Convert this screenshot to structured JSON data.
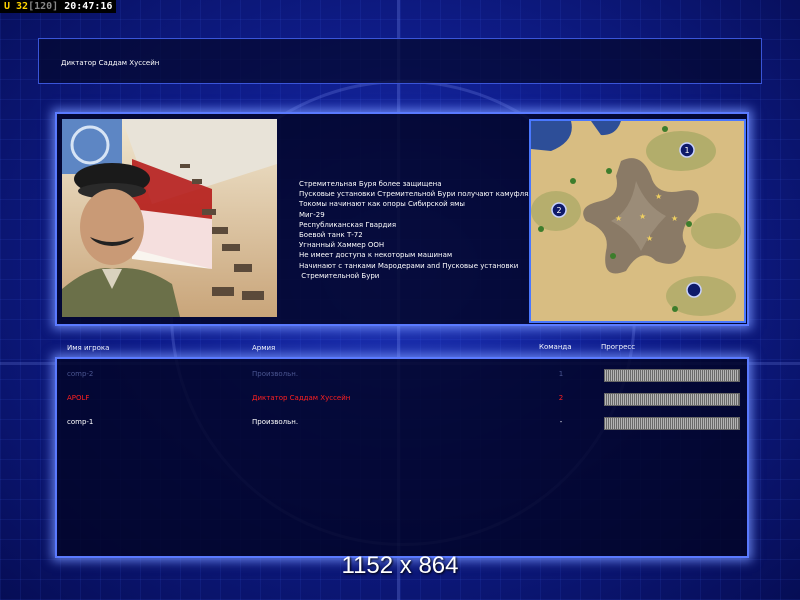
{
  "status_bar": {
    "unit_label": "U 32",
    "unit_max": "[120]",
    "time": "20:47:16"
  },
  "screen_title": "Диктатор Саддам Хуссейн",
  "info_lines": [
    "Стремительная Буря более защищена",
    "Пусковые установки Стремительной Бури получают камуфляж",
    "Токомы начинают как опоры Сибирской ямы",
    "Миг-29",
    "Республиканская Гвардия",
    "Боевой танк Т-72",
    "Угнанный Хаммер ООН",
    "Не имеет доступа к некоторым машинам",
    "Начинают с танками Мародерами and Пусковые установки",
    " Стремительной Бури"
  ],
  "minimap": {
    "start_positions": [
      "1",
      "2"
    ]
  },
  "table_headers": {
    "player": "Имя игрока",
    "army": "Армия",
    "team": "Команда",
    "progress": "Прогресс"
  },
  "players": [
    {
      "name": "comp-2",
      "army": "Произвольн.",
      "team": "1",
      "progress": 1.0,
      "color": "#4a5590"
    },
    {
      "name": "APOLF",
      "army": "Диктатор Саддам Хуссейн",
      "team": "2",
      "progress": 1.0,
      "color": "#ff2020"
    },
    {
      "name": "comp-1",
      "army": "Произвольн.",
      "team": "-",
      "progress": 1.0,
      "color": "#ffffff"
    }
  ],
  "resolution_label": "1152 x 864"
}
